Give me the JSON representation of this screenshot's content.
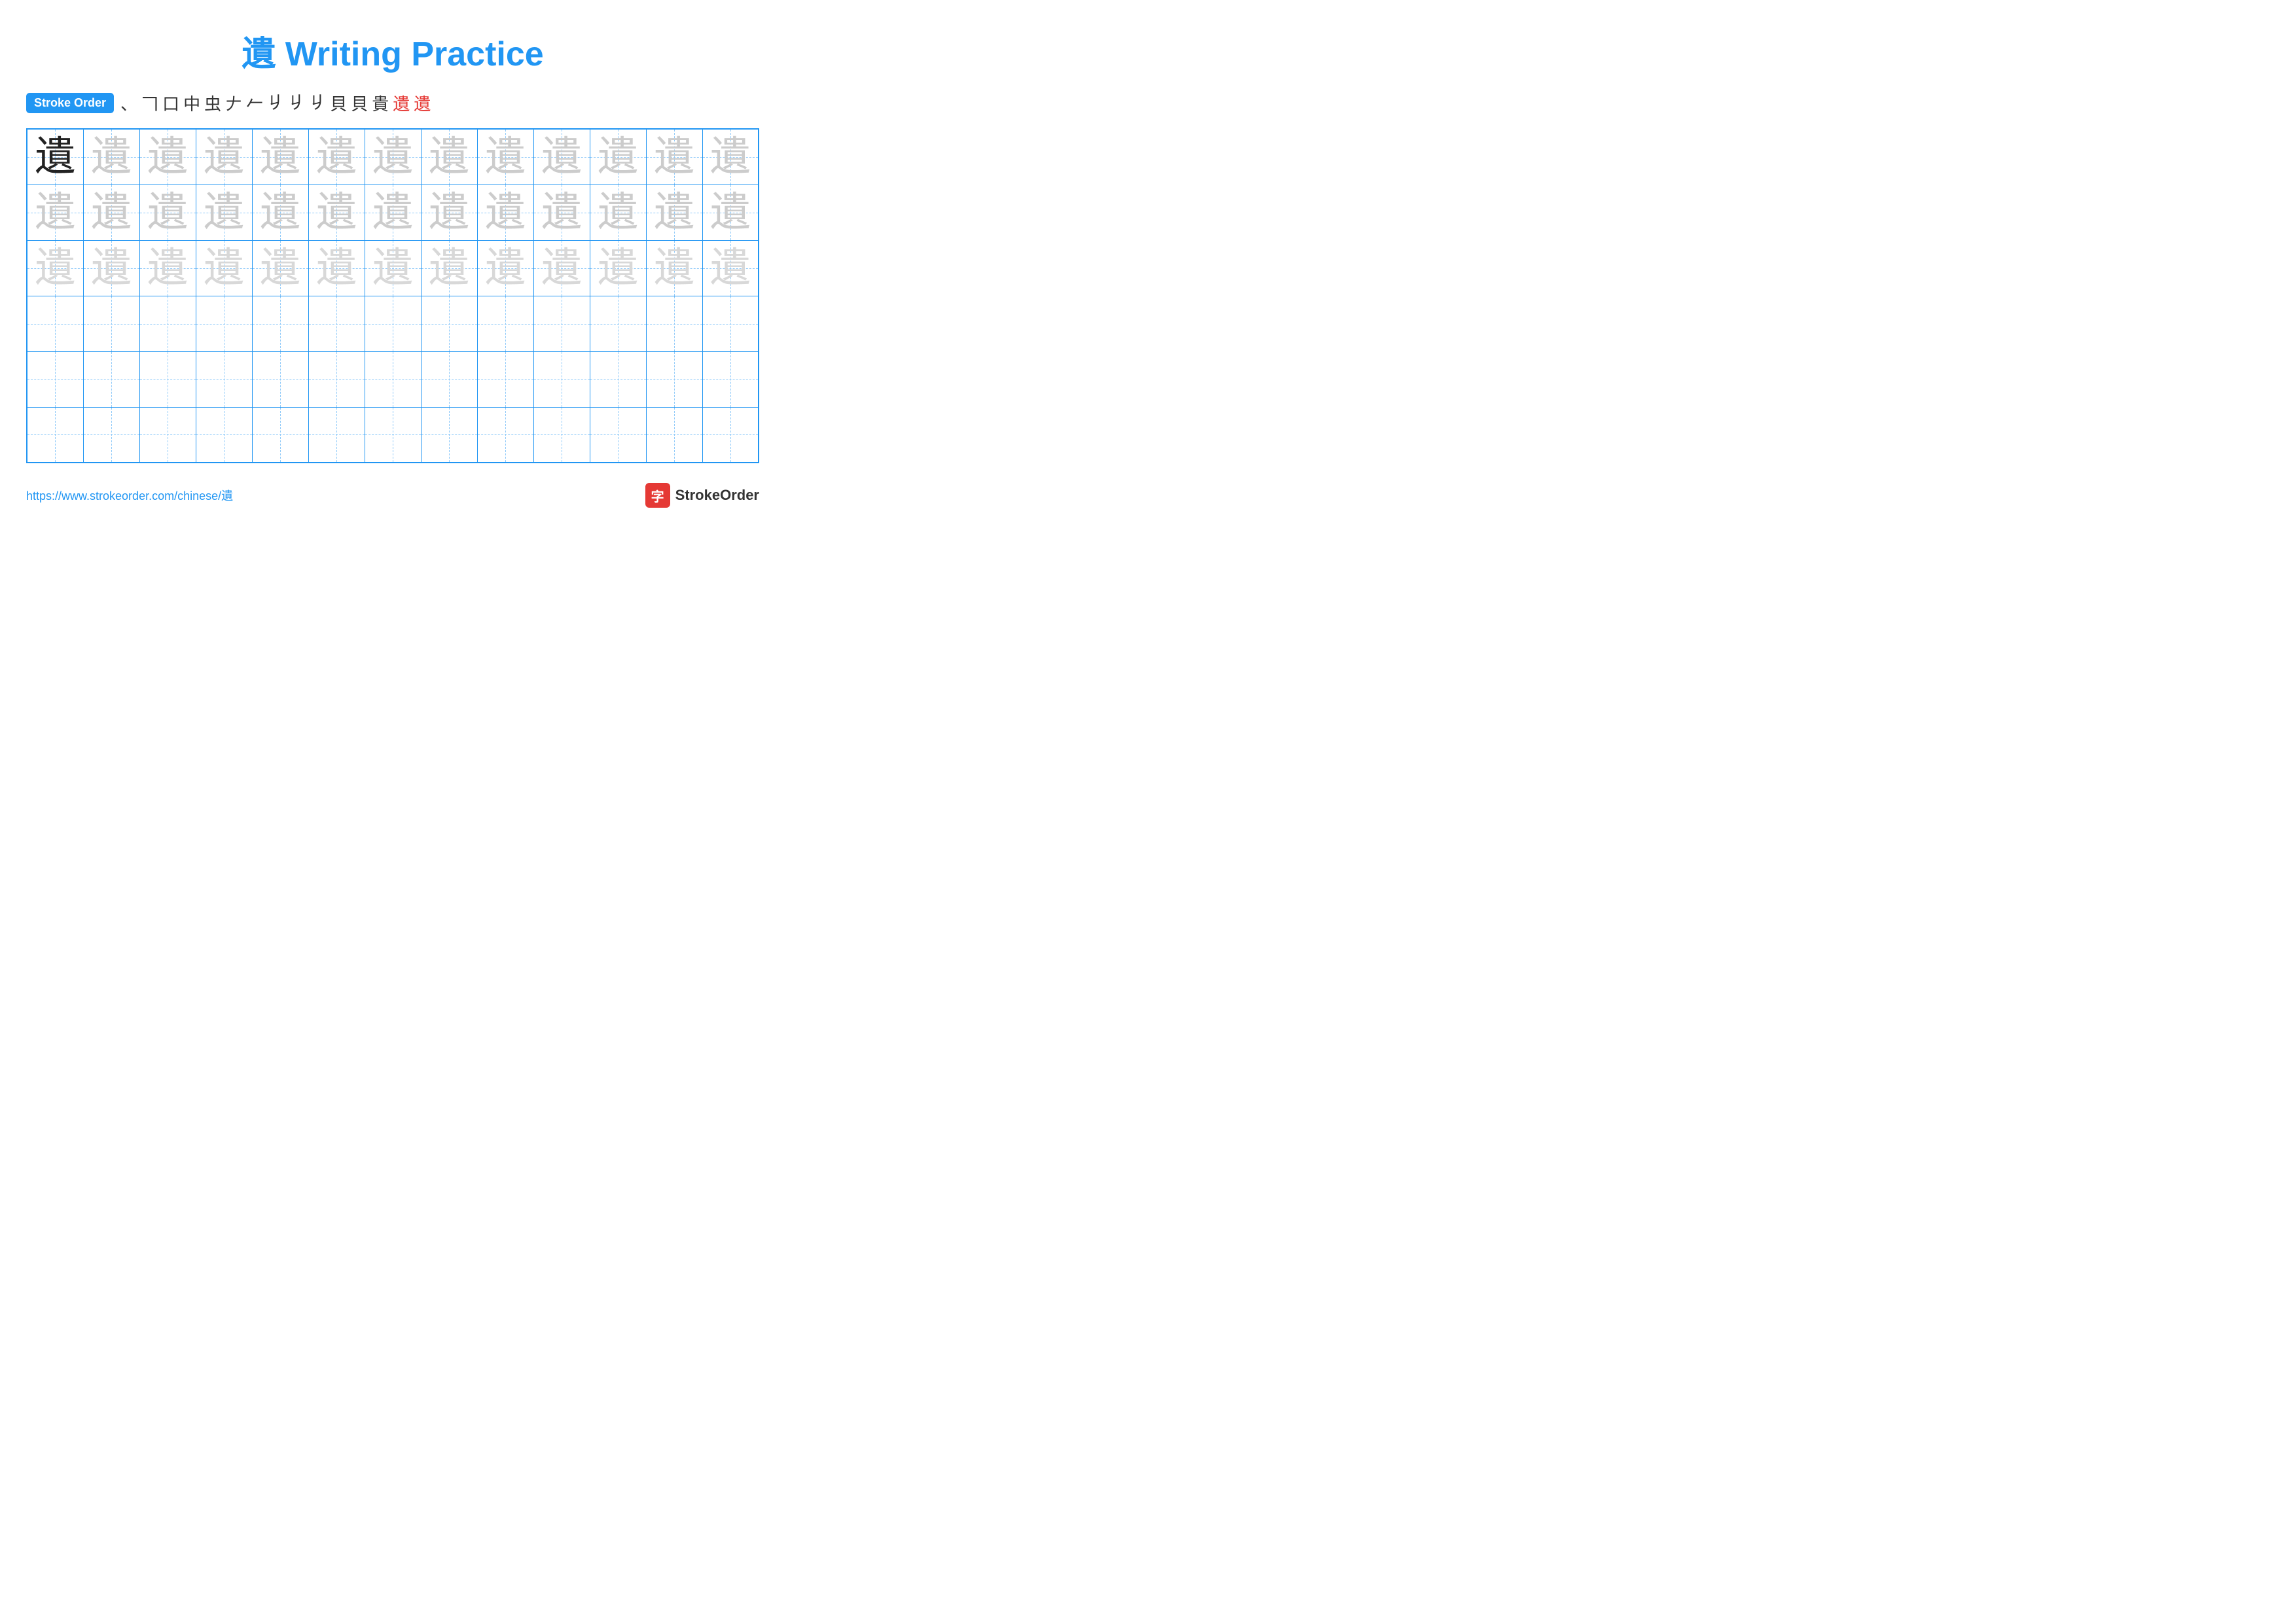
{
  "title": "遺 Writing Practice",
  "stroke_order_label": "Stroke Order",
  "stroke_chars": [
    "、",
    "𠃍",
    "口",
    "中",
    "虫",
    "𠂇",
    "𠂉",
    "𠂈",
    "𠂈",
    "𠂈",
    "貝",
    "貝",
    "貴",
    "遺",
    "遺"
  ],
  "last_two_indices": [
    13,
    14
  ],
  "character": "遺",
  "rows": [
    {
      "type": "practice",
      "cells": 13,
      "first_solid": true,
      "ghost_level": "medium"
    },
    {
      "type": "practice",
      "cells": 13,
      "first_solid": false,
      "ghost_level": "medium"
    },
    {
      "type": "practice",
      "cells": 13,
      "first_solid": false,
      "ghost_level": "light"
    },
    {
      "type": "empty",
      "cells": 13
    },
    {
      "type": "empty",
      "cells": 13
    },
    {
      "type": "empty",
      "cells": 13
    }
  ],
  "footer": {
    "url": "https://www.strokeorder.com/chinese/遺",
    "logo_text": "StrokeOrder",
    "logo_char": "字"
  }
}
